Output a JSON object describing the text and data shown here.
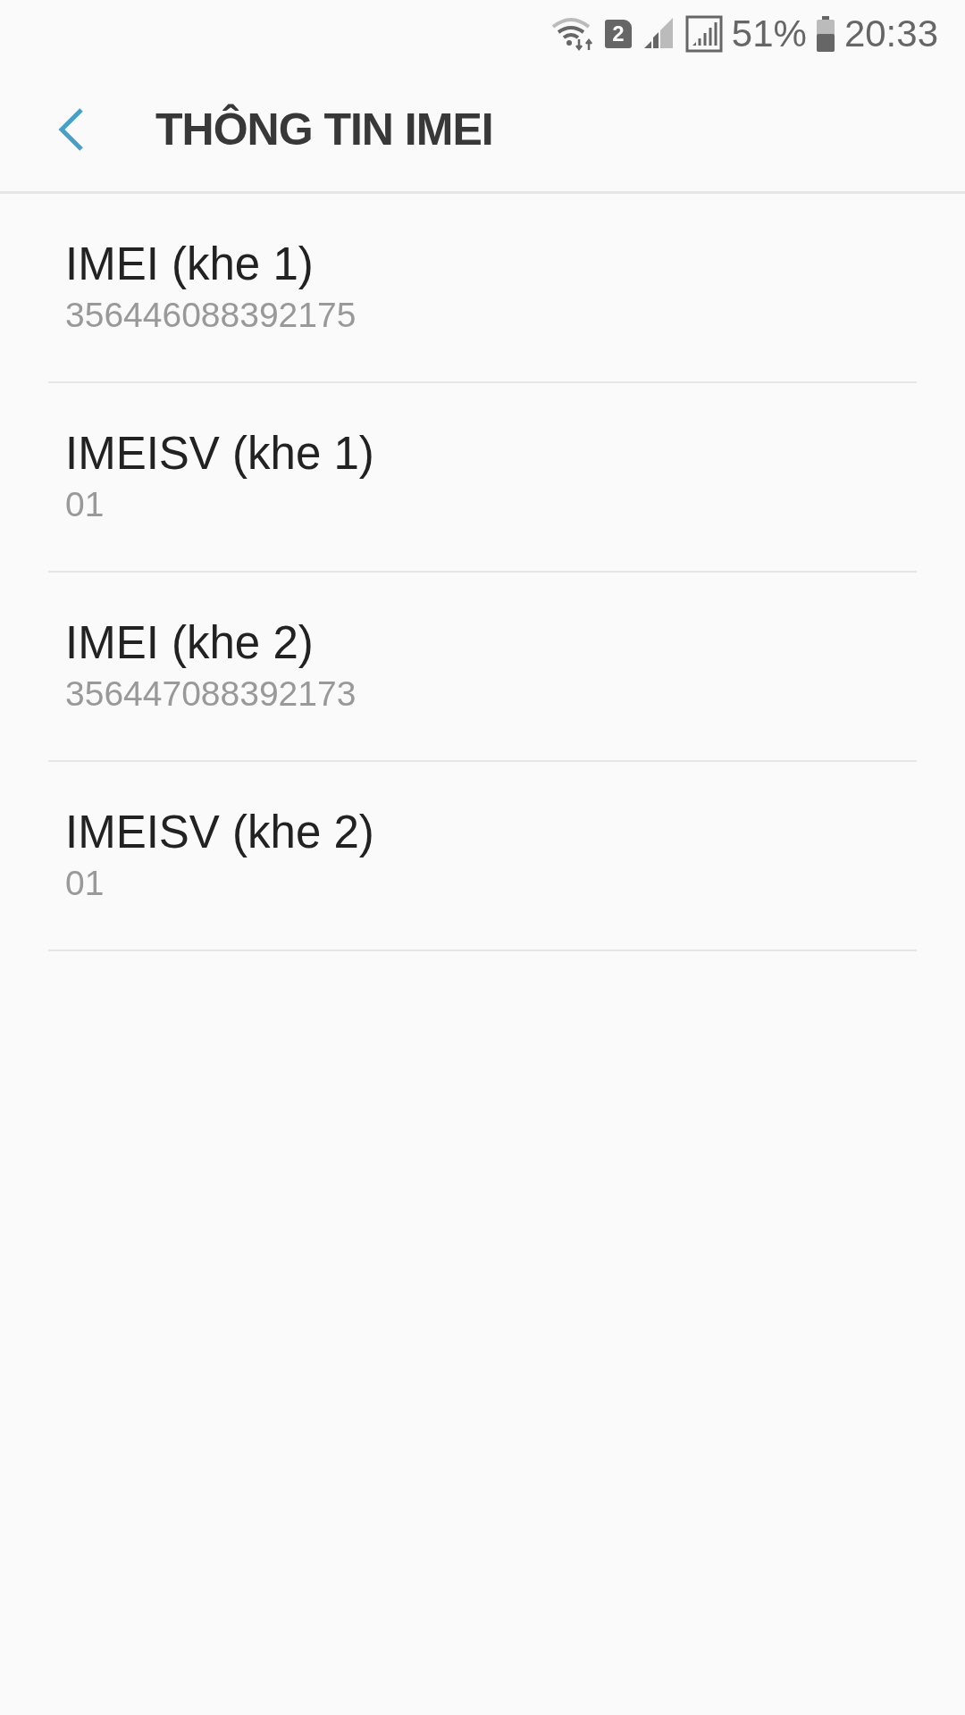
{
  "status_bar": {
    "sim_badge": "2",
    "battery_percent": "51%",
    "time": "20:33"
  },
  "header": {
    "title": "THÔNG TIN IMEI"
  },
  "items": [
    {
      "title": "IMEI (khe 1)",
      "value": "356446088392175"
    },
    {
      "title": "IMEISV (khe 1)",
      "value": "01"
    },
    {
      "title": "IMEI (khe 2)",
      "value": "356447088392173"
    },
    {
      "title": "IMEISV (khe 2)",
      "value": "01"
    }
  ]
}
